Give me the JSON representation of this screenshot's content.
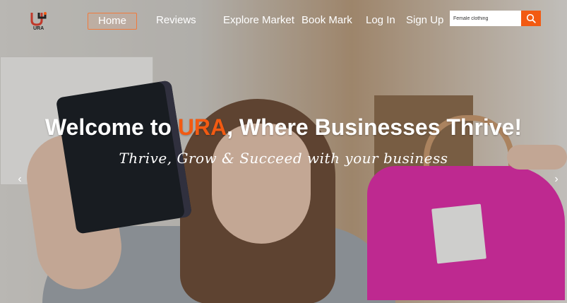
{
  "brand": {
    "logo_text": "URA"
  },
  "nav": {
    "items": [
      {
        "label": "Home",
        "active": true
      },
      {
        "label": "Reviews"
      },
      {
        "label": "Explore Market"
      },
      {
        "label": "Book Mark"
      },
      {
        "label": "Log In"
      },
      {
        "label": "Sign Up"
      }
    ]
  },
  "search": {
    "value": "Female clothing",
    "icon": "search-icon"
  },
  "hero": {
    "headline_prefix": "Welcome to ",
    "headline_brand": "URA",
    "headline_suffix": ", Where  Businesses Thrive!",
    "tagline": "Thrive, Grow & Succeed with your business"
  },
  "carousel": {
    "prev_icon": "chevron-left-icon",
    "next_icon": "chevron-right-icon",
    "prev_glyph": "‹",
    "next_glyph": "›"
  },
  "colors": {
    "accent": "#f25a12",
    "text": "#ffffff"
  }
}
